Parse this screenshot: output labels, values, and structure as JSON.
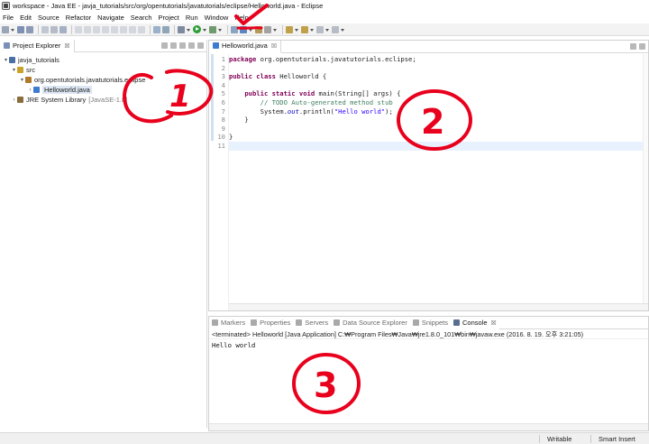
{
  "window": {
    "title": "workspace - Java EE - javja_tutorials/src/org/opentutorials/javatutorials/eclipse/Helloworld.java - Eclipse"
  },
  "menu": [
    "File",
    "Edit",
    "Source",
    "Refactor",
    "Navigate",
    "Search",
    "Project",
    "Run",
    "Window",
    "Help"
  ],
  "explorer": {
    "tab_label": "Project Explorer",
    "close": "☒",
    "tree": [
      {
        "label": "javja_tutorials",
        "level": 0,
        "arrow": "▾",
        "icon": "project-icon",
        "color": "#4a6fa5"
      },
      {
        "label": "src",
        "level": 1,
        "arrow": "▾",
        "icon": "source-folder-icon",
        "color": "#c9a227"
      },
      {
        "label": "org.opentutorials.javatutorials.eclipse",
        "level": 2,
        "arrow": "▾",
        "icon": "package-icon",
        "color": "#b07a2a"
      },
      {
        "label": "Helloworld.java",
        "level": 3,
        "arrow": "›",
        "icon": "java-file-icon",
        "color": "#3d7bd1"
      },
      {
        "label": "JRE System Library",
        "suffix": "[JavaSE-1.8]",
        "level": 1,
        "arrow": "›",
        "icon": "library-icon",
        "color": "#8a6d3b"
      }
    ]
  },
  "editor": {
    "tab_label": "Helloworld.java",
    "close": "☒",
    "line_numbers": [
      "1",
      "2",
      "3",
      "4",
      "5",
      "6",
      "7",
      "8",
      "9",
      "10",
      "11"
    ],
    "lines": {
      "l1": {
        "kw": "package",
        "rest": " org.opentutorials.javatutorials.eclipse;"
      },
      "l3": {
        "kw1": "public",
        "kw2": "class",
        "rest": " Helloworld {"
      },
      "l5": {
        "indent": "    ",
        "kw1": "public",
        "kw2": "static",
        "kw3": "void",
        "rest": " main(String[] args) {"
      },
      "l6": {
        "indent": "        ",
        "comment": "// TODO Auto-generated method stub"
      },
      "l7": {
        "indent": "        ",
        "pre": "System.",
        "field": "out",
        "mid": ".println(",
        "str": "\"Hello world\"",
        "post": ");"
      },
      "l8": {
        "text": "    }"
      },
      "l10": {
        "text": "}"
      }
    }
  },
  "console": {
    "tabs": [
      "Markers",
      "Properties",
      "Servers",
      "Data Source Explorer",
      "Snippets",
      "Console"
    ],
    "close": "☒",
    "info": "<terminated> Helloworld [Java Application] C:₩Program Files₩Java₩jre1.8.0_101₩bin₩javaw.exe (2016. 8. 19. 오후 3:21:05)",
    "output": "Hello world"
  },
  "statusbar": {
    "writable": "Writable",
    "insert_mode": "Smart Insert"
  },
  "annotations": {
    "one": "1",
    "two": "2",
    "three": "3",
    "color": "#e8001c"
  },
  "colors": {
    "keyword": "#7f0055",
    "comment": "#3f7f5f",
    "string": "#2a00ff",
    "selection": "#dde6f3",
    "run_button": "#2e9e3a"
  }
}
